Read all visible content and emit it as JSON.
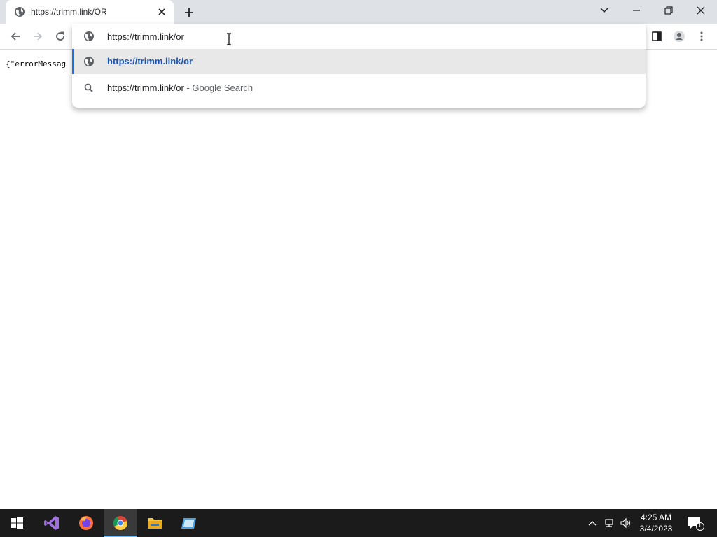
{
  "browser": {
    "tab": {
      "title": "https://trimm.link/OR"
    },
    "omnibox": {
      "input_value": "https://trimm.link/or",
      "suggestions": [
        {
          "type": "url",
          "text": "https://trimm.link/or",
          "selected": true
        },
        {
          "type": "search",
          "text": "https://trimm.link/or",
          "suffix": " - Google Search",
          "selected": false
        }
      ]
    }
  },
  "page": {
    "content_text": "{\"errorMessag"
  },
  "taskbar": {
    "apps": [
      "Visual Studio",
      "Firefox",
      "Google Chrome",
      "File Explorer",
      "Generic app"
    ],
    "active_app": "Google Chrome",
    "clock": {
      "time": "4:25 AM",
      "date": "3/4/2023"
    },
    "notification_count": "1"
  },
  "colors": {
    "accent": "#1a73e8",
    "url_highlight": "#1a56b8",
    "tabstrip": "#dee1e6",
    "taskbar": "#1b1b1b"
  }
}
